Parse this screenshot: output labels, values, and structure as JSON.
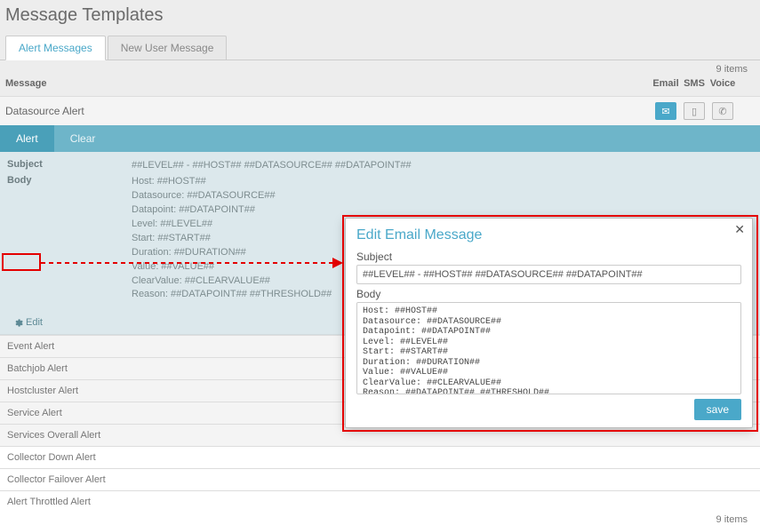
{
  "page": {
    "title": "Message Templates"
  },
  "tabs": {
    "main": [
      {
        "label": "Alert Messages",
        "active": true
      },
      {
        "label": "New User Message",
        "active": false
      }
    ]
  },
  "items_count_top": "9 items",
  "items_count_bottom": "9 items",
  "table": {
    "head": {
      "message": "Message",
      "email": "Email",
      "sms": "SMS",
      "voice": "Voice"
    },
    "selected_row_name": "Datasource Alert"
  },
  "subtabs": [
    {
      "label": "Alert",
      "active": true
    },
    {
      "label": "Clear",
      "active": false
    }
  ],
  "detail": {
    "subject_label": "Subject",
    "subject_value": "##LEVEL## - ##HOST## ##DATASOURCE## ##DATAPOINT##",
    "body_label": "Body",
    "body_value": "Host: ##HOST##\nDatasource: ##DATASOURCE##\nDatapoint: ##DATAPOINT##\nLevel: ##LEVEL##\nStart: ##START##\nDuration: ##DURATION##\nValue: ##VALUE##\nClearValue: ##CLEARVALUE##\nReason: ##DATAPOINT## ##THRESHOLD##"
  },
  "edit_button_label": "Edit",
  "list_rows": [
    "Event Alert",
    "Batchjob Alert",
    "Hostcluster Alert",
    "Service Alert",
    "Services Overall Alert",
    "Collector Down Alert",
    "Collector Failover Alert",
    "Alert Throttled Alert"
  ],
  "modal": {
    "title": "Edit Email Message",
    "subject_label": "Subject",
    "subject_value": "##LEVEL## - ##HOST## ##DATASOURCE## ##DATAPOINT##",
    "body_label": "Body",
    "body_value": "Host: ##HOST##\nDatasource: ##DATASOURCE##\nDatapoint: ##DATAPOINT##\nLevel: ##LEVEL##\nStart: ##START##\nDuration: ##DURATION##\nValue: ##VALUE##\nClearValue: ##CLEARVALUE##\nReason: ##DATAPOINT## ##THRESHOLD##",
    "save_label": "save"
  },
  "icons": {
    "email": "✉",
    "sms": "▯",
    "voice": "✆",
    "close": "✕"
  }
}
